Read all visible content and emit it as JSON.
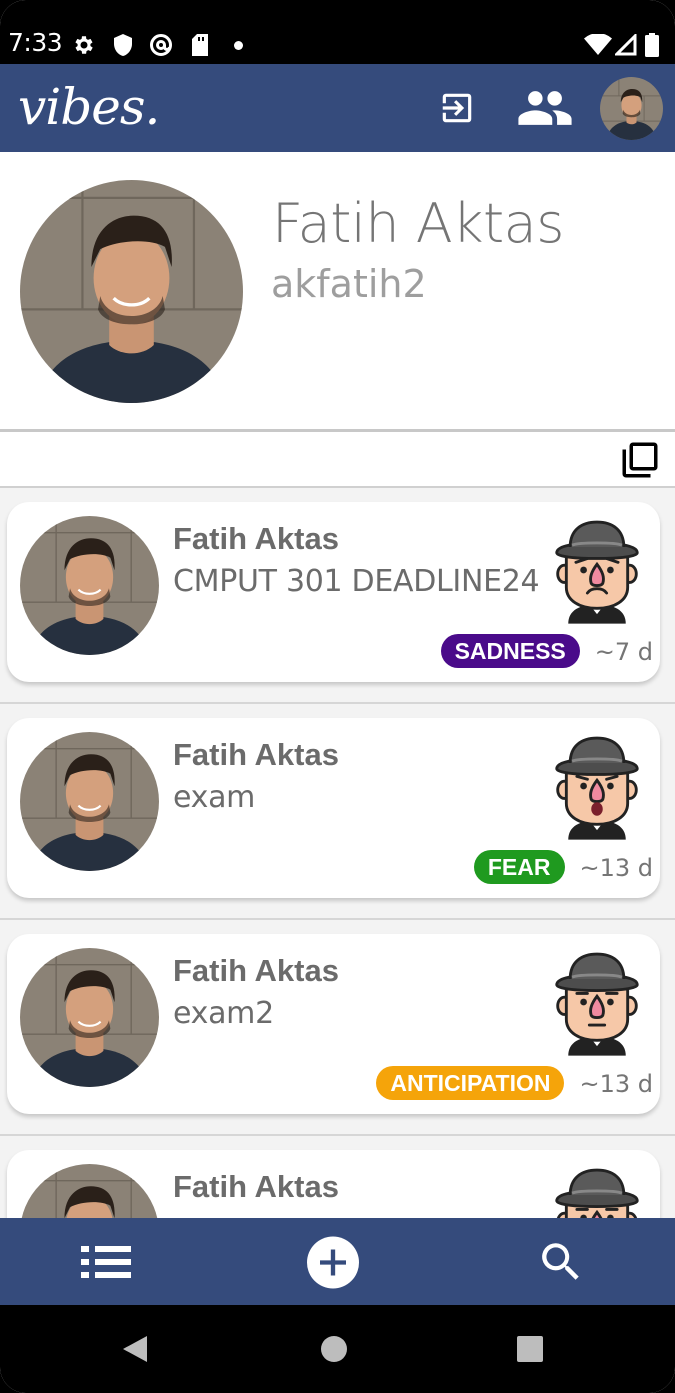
{
  "status_bar": {
    "time": "7:33",
    "icons": [
      "gear-icon",
      "shield-icon",
      "at-sign-icon",
      "sd-card-icon",
      "notification-dot-icon",
      "wifi-icon",
      "signal-icon",
      "battery-icon"
    ]
  },
  "app_bar": {
    "logo": "vibes.",
    "actions": [
      "logout-icon",
      "people-icon",
      "avatar"
    ]
  },
  "profile": {
    "full_name": "Fatih Aktas",
    "username": "akfatih2"
  },
  "feed": {
    "posts": [
      {
        "author": "Fatih Aktas",
        "text": "CMPUT 301 DEADLINE24",
        "emotion": "SADNESS",
        "emotion_color": "#4a0b8a",
        "time": "~7 d",
        "face": "sad"
      },
      {
        "author": "Fatih Aktas",
        "text": "exam",
        "emotion": "FEAR",
        "emotion_color": "#1f9a1f",
        "time": "~13 d",
        "face": "fear"
      },
      {
        "author": "Fatih Aktas",
        "text": "exam2",
        "emotion": "ANTICIPATION",
        "emotion_color": "#f5a40a",
        "time": "~13 d",
        "face": "neutral"
      },
      {
        "author": "Fatih Aktas",
        "text": "",
        "emotion": "",
        "emotion_color": "#888888",
        "time": "",
        "face": "neutral"
      }
    ]
  },
  "bottom_nav": {
    "items": [
      "list-icon",
      "add-circle-icon",
      "search-icon"
    ]
  },
  "colors": {
    "primary": "#354b7c",
    "text_gray": "#6b6b6b"
  }
}
